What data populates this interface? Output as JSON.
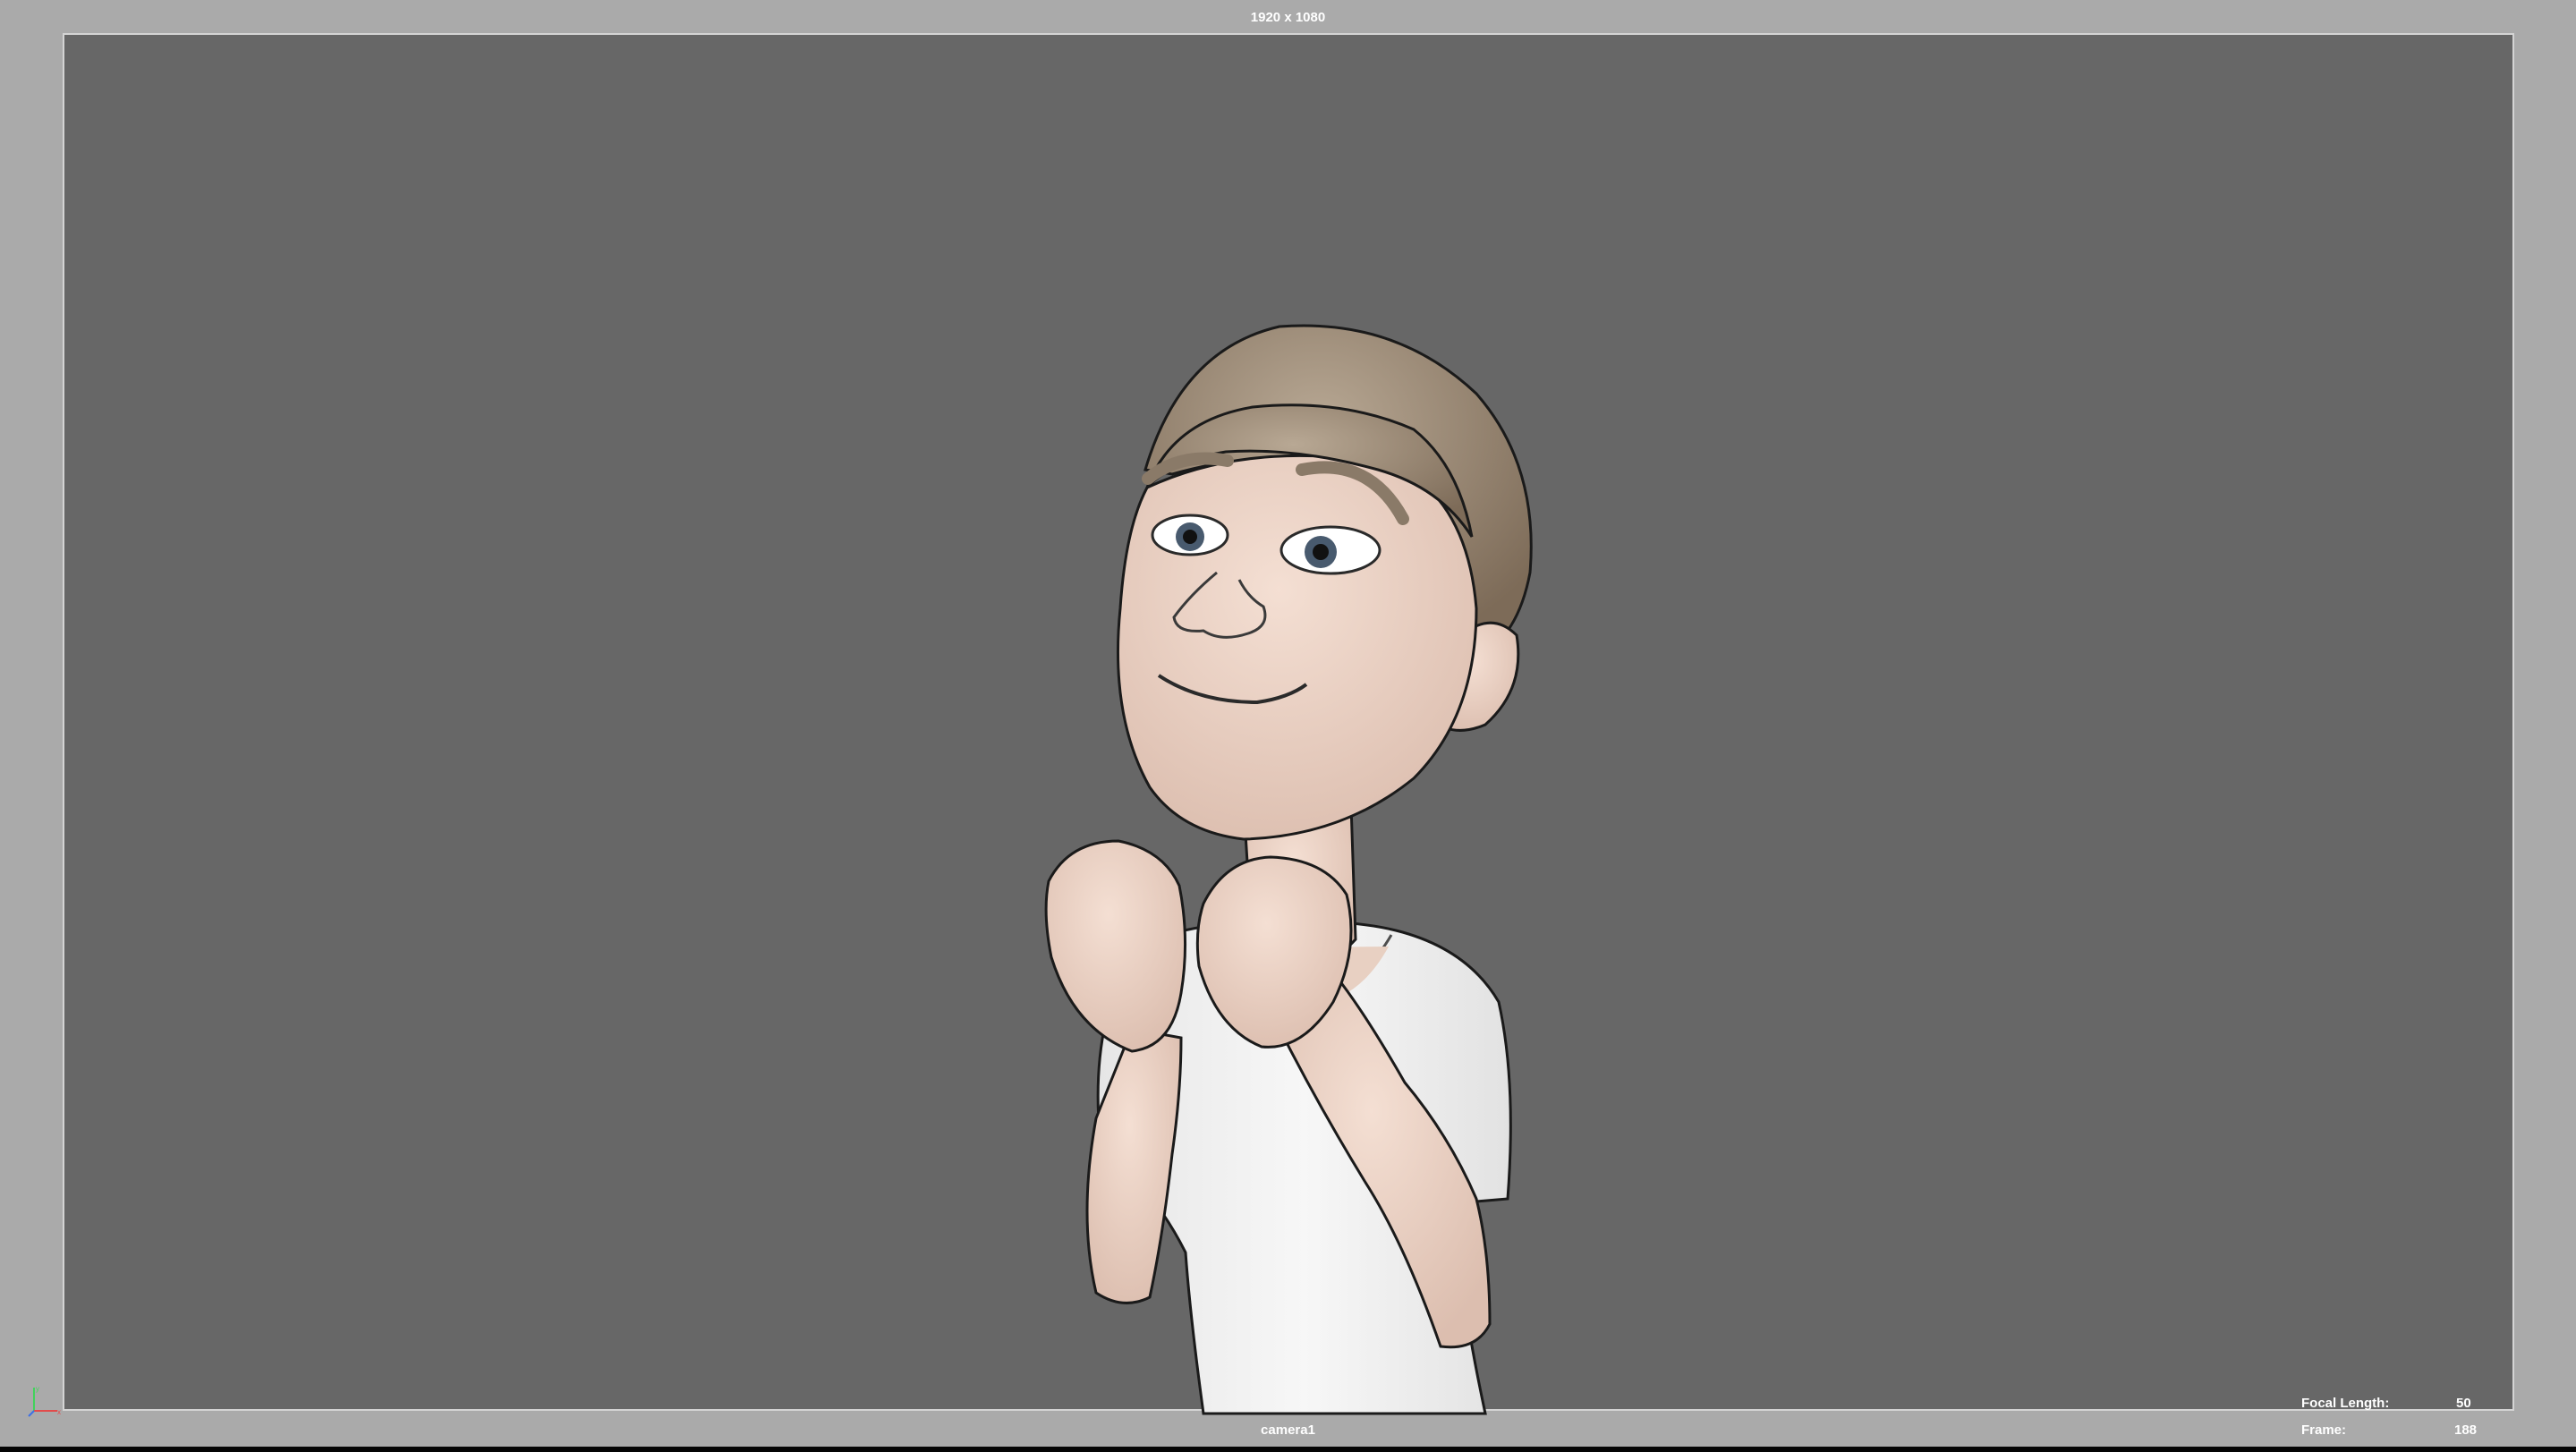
{
  "viewport": {
    "resolution": "1920 x 1080",
    "camera": "camera1",
    "hud": {
      "focal_length_label": "Focal Length:",
      "focal_length_value": "50",
      "frame_label": "Frame:",
      "frame_value": "188"
    }
  },
  "icons": {
    "axis_gizmo": "axis-triad-icon"
  },
  "colors": {
    "viewport_border": "#aaaaaa",
    "background": "#676767",
    "resolution_gate": "#d4d4d4",
    "hud_text": "#ffffff",
    "skin": "#f0d5c6",
    "hair": "#8c7b66",
    "shirt": "#f0f0f0"
  }
}
